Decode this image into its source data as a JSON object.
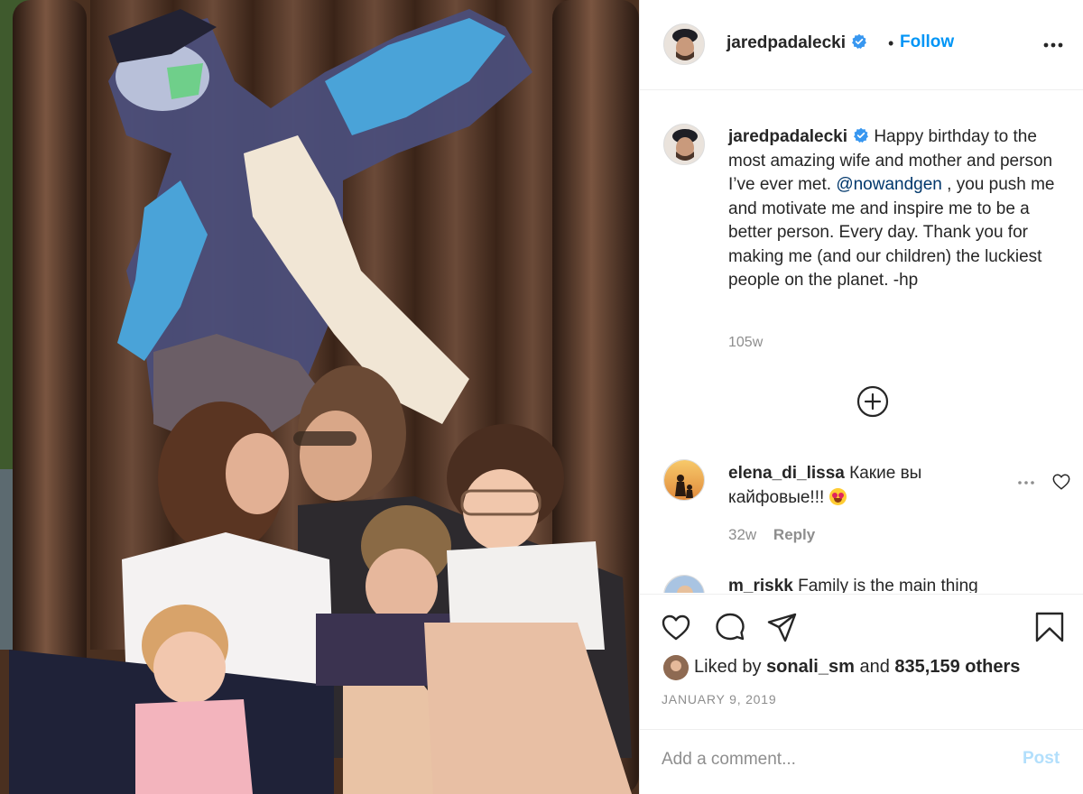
{
  "post": {
    "username": "jaredpadalecki",
    "verified": true,
    "follow_label": "Follow",
    "dot": "•",
    "caption": {
      "username": "jaredpadalecki",
      "text_before_mention": "Happy birthday to the most amazing wife and mother and person I’ve ever met.",
      "mention": "@nowandgen",
      "text_after_mention": ", you push me and motivate me and inspire me to be a better person. Every day. Thank you for making me (and our children) the luckiest people on the planet. -hp",
      "time": "105w"
    },
    "comments": [
      {
        "username": "elena_di_lissa",
        "text": "Какие вы кайфовые!!!",
        "time": "32w",
        "reply_label": "Reply"
      },
      {
        "username": "m_riskk",
        "text": "Family is the main thing"
      }
    ],
    "likes": {
      "prefix": "Liked by",
      "user": "sonali_sm",
      "middle": "and",
      "count_text": "835,159 others"
    },
    "date": "JANUARY 9, 2019",
    "add_comment": {
      "placeholder": "Add a comment...",
      "post_label": "Post"
    },
    "icons": {
      "more": "more-horizontal-icon",
      "verified": "verified-badge-icon",
      "load_more": "plus-circle-icon",
      "like": "heart-icon",
      "comment": "comment-icon",
      "share": "share-icon",
      "save": "bookmark-icon"
    },
    "colors": {
      "accent": "#0095f6",
      "verified": "#3897f0",
      "muted": "#8e8e8e",
      "mention": "#00376b"
    }
  }
}
